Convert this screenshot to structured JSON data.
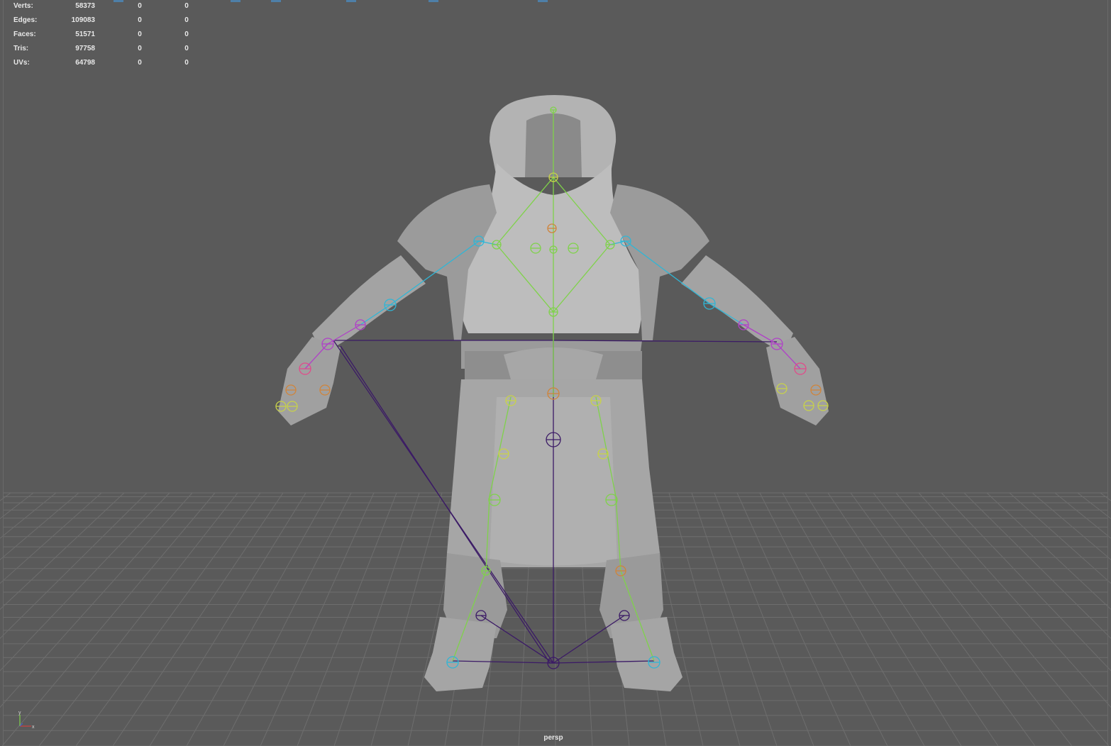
{
  "hud": {
    "rows": [
      {
        "label": "Verts:",
        "v1": "58373",
        "v2": "0",
        "v3": "0"
      },
      {
        "label": "Edges:",
        "v1": "109083",
        "v2": "0",
        "v3": "0"
      },
      {
        "label": "Faces:",
        "v1": "51571",
        "v2": "0",
        "v3": "0"
      },
      {
        "label": "Tris:",
        "v1": "97758",
        "v2": "0",
        "v3": "0"
      },
      {
        "label": "UVs:",
        "v1": "64798",
        "v2": "0",
        "v3": "0"
      }
    ]
  },
  "camera": {
    "name": "persp"
  },
  "axis": {
    "y_label": "y",
    "x_label": "x"
  },
  "colors": {
    "background": "#5a5a5a",
    "grid": "#6e6e6e",
    "model": "#a9a9a9",
    "joint_spine": "#7fd24a",
    "joint_arm": "#2fb6d6",
    "joint_hand": "#b040c8",
    "joint_finger": "#e24a8a",
    "ik_line": "#3b1a66",
    "joint_orange": "#d0843a",
    "joint_yellow": "#c8d24a"
  },
  "icons": [
    "axis-gizmo-icon"
  ]
}
